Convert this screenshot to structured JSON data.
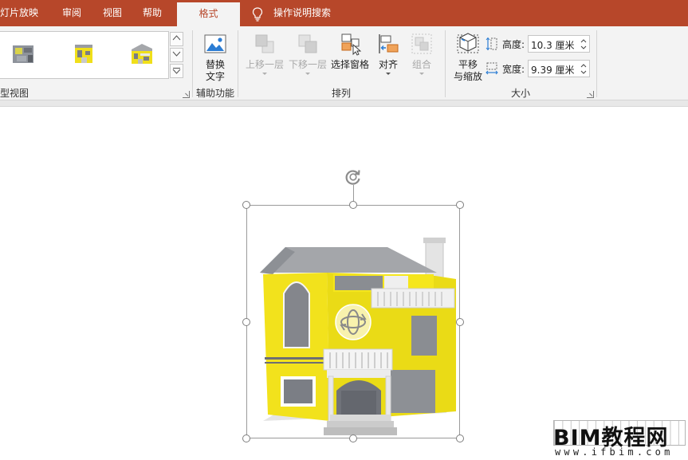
{
  "tabs": [
    {
      "label": "灯片放映"
    },
    {
      "label": "审阅"
    },
    {
      "label": "视图"
    },
    {
      "label": "帮助"
    },
    {
      "label": "格式",
      "active": true
    },
    {
      "label": "操作说明搜索"
    }
  ],
  "colors": {
    "accent": "#b7472a",
    "model_yellow": "#f2e21c",
    "ribbon_bg": "#f3f3f3"
  },
  "ribbon": {
    "model_views_group": {
      "label": "型视图"
    },
    "accessibility_group": {
      "label": "辅助功能",
      "alt_text_button": {
        "line1": "替换",
        "line2": "文字"
      }
    },
    "arrange_group": {
      "label": "排列",
      "bring_forward": "上移一层",
      "send_backward": "下移一层",
      "selection_pane": "选择窗格",
      "align": "对齐",
      "group": "组合"
    },
    "size_group": {
      "label": "大小",
      "pan_zoom": {
        "line1": "平移",
        "line2": "与缩放"
      },
      "height_label": "高度:",
      "height_value": "10.3 厘米",
      "width_label": "宽度:",
      "width_value": "9.39 厘米"
    }
  },
  "icons": {
    "tell_me": "lightbulb-icon",
    "rotate": "rotate-handle-icon",
    "orbit": "3d-orbit-icon"
  },
  "watermark": {
    "main": "BIM教程网",
    "sub": "www.ifbim.com"
  }
}
